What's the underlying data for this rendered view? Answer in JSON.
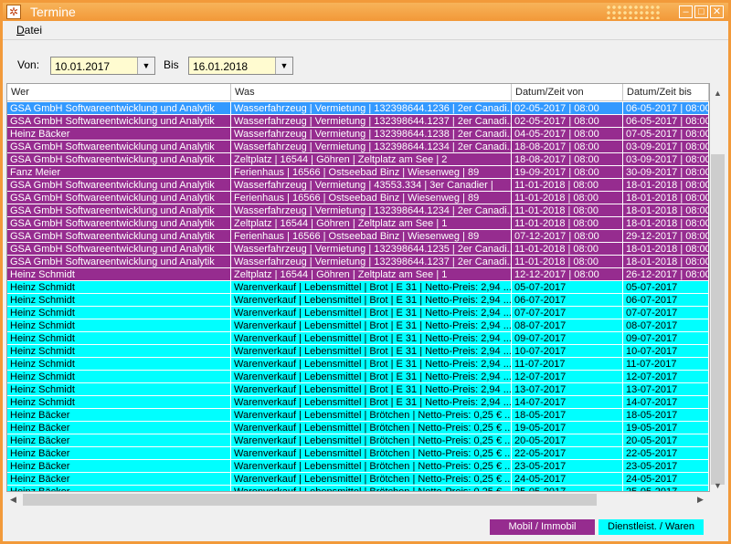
{
  "window": {
    "title": "Termine"
  },
  "menu": {
    "datei": "Datei"
  },
  "filter": {
    "von_label": "Von:",
    "von_value": "10.01.2017",
    "bis_label": "Bis",
    "bis_value": "16.01.2018"
  },
  "colors": {
    "mobil": "#962c8f",
    "waren": "#00ffff",
    "selected": "#3399ff"
  },
  "table": {
    "columns": [
      "Wer",
      "Was",
      "Datum/Zeit von",
      "Datum/Zeit bis"
    ],
    "rows": [
      {
        "type": "sel",
        "cells": [
          "GSA GmbH Softwareentwicklung und Analytik",
          "Wasserfahrzeug | Vermietung | 132398644.1236 | 2er Canadi...",
          "02-05-2017 | 08:00",
          "06-05-2017 | 08:00"
        ]
      },
      {
        "type": "mobil",
        "cells": [
          "GSA GmbH Softwareentwicklung und Analytik",
          "Wasserfahrzeug | Vermietung | 132398644.1237 | 2er Canadi...",
          "02-05-2017 | 08:00",
          "06-05-2017 | 08:00"
        ]
      },
      {
        "type": "mobil",
        "cells": [
          "Heinz Bäcker",
          "Wasserfahrzeug | Vermietung | 132398644.1238 | 2er Canadi...",
          "04-05-2017 | 08:00",
          "07-05-2017 | 08:00"
        ]
      },
      {
        "type": "mobil",
        "cells": [
          "GSA GmbH Softwareentwicklung und Analytik",
          "Wasserfahrzeug | Vermietung | 132398644.1234 | 2er Canadi...",
          "18-08-2017 | 08:00",
          "03-09-2017 | 08:00"
        ]
      },
      {
        "type": "mobil",
        "cells": [
          "GSA GmbH Softwareentwicklung und Analytik",
          "Zeltplatz | 16544 | Göhren | Zeltplatz am See | 2",
          "18-08-2017 | 08:00",
          "03-09-2017 | 08:00"
        ]
      },
      {
        "type": "mobil",
        "cells": [
          "Fanz Meier",
          "Ferienhaus | 16566 | Ostseebad Binz | Wiesenweg | 89",
          "19-09-2017 | 08:00",
          "30-09-2017 | 08:00"
        ]
      },
      {
        "type": "mobil",
        "cells": [
          "GSA GmbH Softwareentwicklung und Analytik",
          "Wasserfahrzeug | Vermietung | 43553.334 | 3er Canadier |",
          "11-01-2018 | 08:00",
          "18-01-2018 | 08:00"
        ]
      },
      {
        "type": "mobil",
        "cells": [
          "GSA GmbH Softwareentwicklung und Analytik",
          "Ferienhaus | 16566 | Ostseebad Binz | Wiesenweg | 89",
          "11-01-2018 | 08:00",
          "18-01-2018 | 08:00"
        ]
      },
      {
        "type": "mobil",
        "cells": [
          "GSA GmbH Softwareentwicklung und Analytik",
          "Wasserfahrzeug | Vermietung | 132398644.1234 | 2er Canadi...",
          "11-01-2018 | 08:00",
          "18-01-2018 | 08:00"
        ]
      },
      {
        "type": "mobil",
        "cells": [
          "GSA GmbH Softwareentwicklung und Analytik",
          "Zeltplatz | 16544 | Göhren | Zeltplatz am See | 1",
          "11-01-2018 | 08:00",
          "18-01-2018 | 08:00"
        ]
      },
      {
        "type": "mobil",
        "cells": [
          "GSA GmbH Softwareentwicklung und Analytik",
          "Ferienhaus | 16566 | Ostseebad Binz | Wiesenweg | 89",
          "07-12-2017 | 08:00",
          "29-12-2017 | 08:00"
        ]
      },
      {
        "type": "mobil",
        "cells": [
          "GSA GmbH Softwareentwicklung und Analytik",
          "Wasserfahrzeug | Vermietung | 132398644.1235 | 2er Canadi...",
          "11-01-2018 | 08:00",
          "18-01-2018 | 08:00"
        ]
      },
      {
        "type": "mobil",
        "cells": [
          "GSA GmbH Softwareentwicklung und Analytik",
          "Wasserfahrzeug | Vermietung | 132398644.1237 | 2er Canadi...",
          "11-01-2018 | 08:00",
          "18-01-2018 | 08:00"
        ]
      },
      {
        "type": "mobil",
        "cells": [
          "Heinz Schmidt",
          "Zeltplatz | 16544 | Göhren | Zeltplatz am See | 1",
          "12-12-2017 | 08:00",
          "26-12-2017 | 08:00"
        ]
      },
      {
        "type": "waren",
        "cells": [
          "Heinz Schmidt",
          "Warenverkauf | Lebensmittel | Brot | E 31 | Netto-Preis: 2,94 ...",
          "05-07-2017",
          "05-07-2017"
        ]
      },
      {
        "type": "waren",
        "cells": [
          "Heinz Schmidt",
          "Warenverkauf | Lebensmittel | Brot | E 31 | Netto-Preis: 2,94 ...",
          "06-07-2017",
          "06-07-2017"
        ]
      },
      {
        "type": "waren",
        "cells": [
          "Heinz Schmidt",
          "Warenverkauf | Lebensmittel | Brot | E 31 | Netto-Preis: 2,94 ...",
          "07-07-2017",
          "07-07-2017"
        ]
      },
      {
        "type": "waren",
        "cells": [
          "Heinz Schmidt",
          "Warenverkauf | Lebensmittel | Brot | E 31 | Netto-Preis: 2,94 ...",
          "08-07-2017",
          "08-07-2017"
        ]
      },
      {
        "type": "waren",
        "cells": [
          "Heinz Schmidt",
          "Warenverkauf | Lebensmittel | Brot | E 31 | Netto-Preis: 2,94 ...",
          "09-07-2017",
          "09-07-2017"
        ]
      },
      {
        "type": "waren",
        "cells": [
          "Heinz Schmidt",
          "Warenverkauf | Lebensmittel | Brot | E 31 | Netto-Preis: 2,94 ...",
          "10-07-2017",
          "10-07-2017"
        ]
      },
      {
        "type": "waren",
        "cells": [
          "Heinz Schmidt",
          "Warenverkauf | Lebensmittel | Brot | E 31 | Netto-Preis: 2,94 ...",
          "11-07-2017",
          "11-07-2017"
        ]
      },
      {
        "type": "waren",
        "cells": [
          "Heinz Schmidt",
          "Warenverkauf | Lebensmittel | Brot | E 31 | Netto-Preis: 2,94 ...",
          "12-07-2017",
          "12-07-2017"
        ]
      },
      {
        "type": "waren",
        "cells": [
          "Heinz Schmidt",
          "Warenverkauf | Lebensmittel | Brot | E 31 | Netto-Preis: 2,94 ...",
          "13-07-2017",
          "13-07-2017"
        ]
      },
      {
        "type": "waren",
        "cells": [
          "Heinz Schmidt",
          "Warenverkauf | Lebensmittel | Brot | E 31 | Netto-Preis: 2,94 ...",
          "14-07-2017",
          "14-07-2017"
        ]
      },
      {
        "type": "waren",
        "cells": [
          "Heinz Bäcker",
          "Warenverkauf | Lebensmittel | Brötchen | Netto-Preis: 0,25 € ...",
          "18-05-2017",
          "18-05-2017"
        ]
      },
      {
        "type": "waren",
        "cells": [
          "Heinz Bäcker",
          "Warenverkauf | Lebensmittel | Brötchen | Netto-Preis: 0,25 € ...",
          "19-05-2017",
          "19-05-2017"
        ]
      },
      {
        "type": "waren",
        "cells": [
          "Heinz Bäcker",
          "Warenverkauf | Lebensmittel | Brötchen | Netto-Preis: 0,25 € ...",
          "20-05-2017",
          "20-05-2017"
        ]
      },
      {
        "type": "waren",
        "cells": [
          "Heinz Bäcker",
          "Warenverkauf | Lebensmittel | Brötchen | Netto-Preis: 0,25 € ...",
          "22-05-2017",
          "22-05-2017"
        ]
      },
      {
        "type": "waren",
        "cells": [
          "Heinz Bäcker",
          "Warenverkauf | Lebensmittel | Brötchen | Netto-Preis: 0,25 € ...",
          "23-05-2017",
          "23-05-2017"
        ]
      },
      {
        "type": "waren",
        "cells": [
          "Heinz Bäcker",
          "Warenverkauf | Lebensmittel | Brötchen | Netto-Preis: 0,25 € ...",
          "24-05-2017",
          "24-05-2017"
        ]
      },
      {
        "type": "waren",
        "cells": [
          "Heinz Bäcker",
          "Warenverkauf | Lebensmittel | Brötchen | Netto-Preis: 0,25 € ...",
          "25-05-2017",
          "25-05-2017"
        ]
      }
    ]
  },
  "legend": {
    "mobil": "Mobil / Immobil",
    "waren": "Dienstleist. / Waren"
  }
}
